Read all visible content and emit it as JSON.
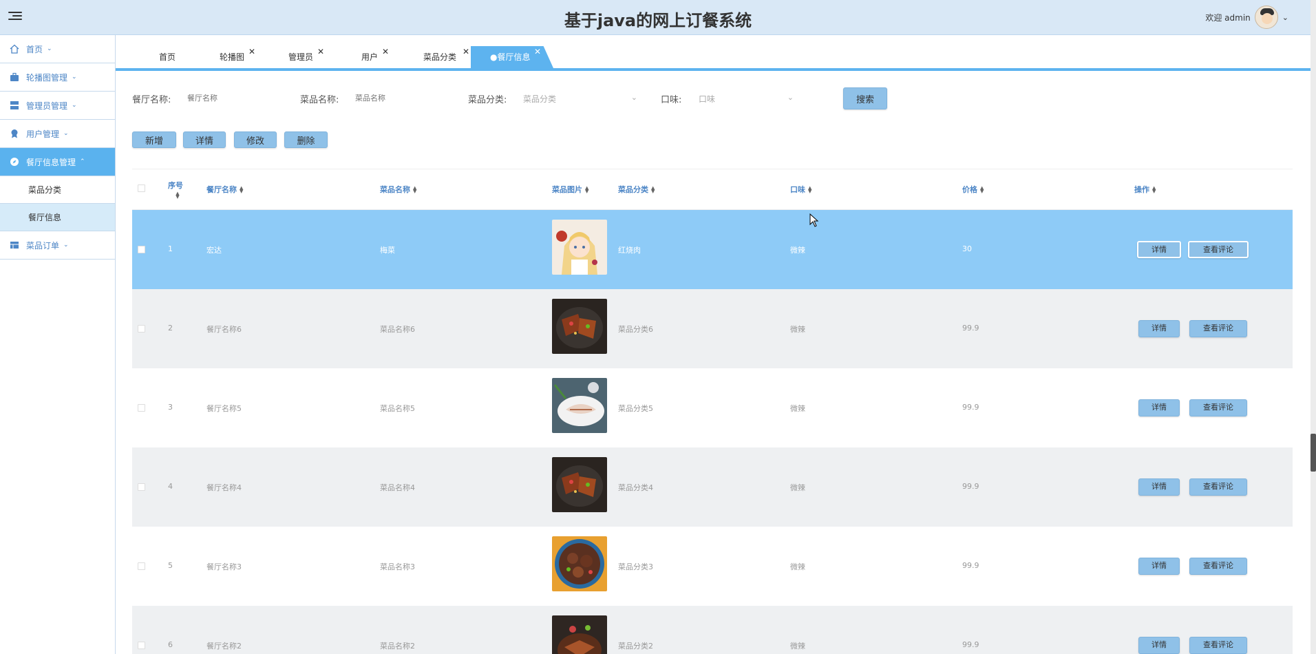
{
  "header": {
    "title": "基于java的网上订餐系统",
    "welcome": "欢迎 admin"
  },
  "sidebar": {
    "items": [
      {
        "label": "首页"
      },
      {
        "label": "轮播图管理"
      },
      {
        "label": "管理员管理"
      },
      {
        "label": "用户管理"
      },
      {
        "label": "餐厅信息管理"
      }
    ],
    "sub_items": [
      {
        "label": "菜品分类"
      },
      {
        "label": "餐厅信息"
      }
    ],
    "last_item": {
      "label": "菜品订单"
    }
  },
  "tabs": [
    {
      "label": "首页"
    },
    {
      "label": "轮播图"
    },
    {
      "label": "管理员"
    },
    {
      "label": "用户"
    },
    {
      "label": "菜品分类"
    }
  ],
  "active_tab": {
    "label": "●餐厅信息"
  },
  "tab_close": "✕",
  "search": {
    "restaurant_label": "餐厅名称:",
    "restaurant_placeholder": "餐厅名称",
    "dish_label": "菜品名称:",
    "dish_placeholder": "菜品名称",
    "category_label": "菜品分类:",
    "category_placeholder": "菜品分类",
    "taste_label": "口味:",
    "taste_placeholder": "口味",
    "search_button": "搜索"
  },
  "toolbar": {
    "add": "新增",
    "detail": "详情",
    "edit": "修改",
    "delete": "删除"
  },
  "table": {
    "columns": [
      "序号",
      "餐厅名称",
      "菜品名称",
      "菜品图片",
      "菜品分类",
      "口味",
      "价格",
      "操作"
    ],
    "rows": [
      {
        "no": "1",
        "restaurant": "宏达",
        "dish": "梅菜",
        "category": "红烧肉",
        "taste": "微辣",
        "price": "30",
        "image": "anime-girl"
      },
      {
        "no": "2",
        "restaurant": "餐厅名称6",
        "dish": "菜品名称6",
        "category": "菜品分类6",
        "taste": "微辣",
        "price": "99.9",
        "image": "grilled-meat"
      },
      {
        "no": "3",
        "restaurant": "餐厅名称5",
        "dish": "菜品名称5",
        "category": "菜品分类5",
        "taste": "微辣",
        "price": "99.9",
        "image": "sliced-pork"
      },
      {
        "no": "4",
        "restaurant": "餐厅名称4",
        "dish": "菜品名称4",
        "category": "菜品分类4",
        "taste": "微辣",
        "price": "99.9",
        "image": "grilled-meat"
      },
      {
        "no": "5",
        "restaurant": "餐厅名称3",
        "dish": "菜品名称3",
        "category": "菜品分类3",
        "taste": "微辣",
        "price": "99.9",
        "image": "braised-meat"
      },
      {
        "no": "6",
        "restaurant": "餐厅名称2",
        "dish": "菜品名称2",
        "category": "菜品分类2",
        "taste": "微辣",
        "price": "99.9",
        "image": "fried-dish"
      }
    ],
    "detail_button": "详情",
    "comments_button": "查看评论"
  },
  "colors": {
    "accent": "#5db3ef",
    "selected_row": "#8ecbf7",
    "button": "#8fc1e8",
    "header_bg": "#d9e8f6"
  }
}
